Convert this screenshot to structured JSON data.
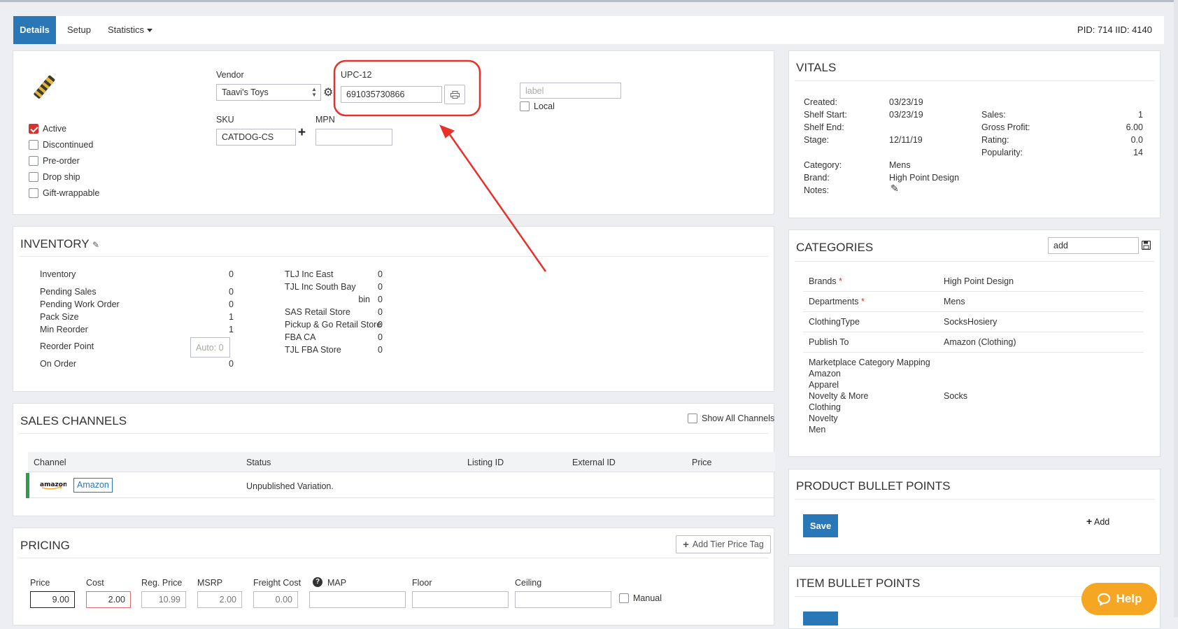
{
  "tabs": [
    {
      "label": "Details"
    },
    {
      "label": "Setup"
    },
    {
      "label": "Statistics"
    }
  ],
  "pid_text": "PID: 714 IID: 4140",
  "product": {
    "vendor_label": "Vendor",
    "vendor_value": "Taavi's Toys",
    "upc_label": "UPC-12",
    "upc_value": "691035730866",
    "label_placeholder": "label",
    "local_label": "Local",
    "sku_label": "SKU",
    "sku_value": "CATDOG-CS",
    "mpn_label": "MPN",
    "mpn_value": "",
    "flags": [
      {
        "label": "Active",
        "checked": true
      },
      {
        "label": "Discontinued",
        "checked": false
      },
      {
        "label": "Pre-order",
        "checked": false
      },
      {
        "label": "Drop ship",
        "checked": false
      },
      {
        "label": "Gift-wrappable",
        "checked": false
      }
    ]
  },
  "inventory": {
    "title": "INVENTORY",
    "left": [
      {
        "label": "Inventory",
        "value": "0"
      },
      {
        "label": "Pending Sales",
        "value": "0"
      },
      {
        "label": "Pending Work Order",
        "value": "0"
      },
      {
        "label": "Pack Size",
        "value": "1"
      },
      {
        "label": "Min Reorder",
        "value": "1"
      },
      {
        "label": "Reorder Point",
        "placeholder": "Auto: 0"
      },
      {
        "label": "On Order",
        "value": "0"
      }
    ],
    "right": [
      {
        "label": "TLJ Inc East",
        "value": "0"
      },
      {
        "label": "TJL Inc South Bay",
        "value": "0"
      },
      {
        "label": "bin",
        "value": "0"
      },
      {
        "label": "SAS Retail Store",
        "value": "0"
      },
      {
        "label": "Pickup & Go Retail Store",
        "value": "0"
      },
      {
        "label": "FBA CA",
        "value": "0"
      },
      {
        "label": "TJL FBA Store",
        "value": "0"
      }
    ]
  },
  "sales_channels": {
    "title": "SALES CHANNELS",
    "show_all_label": "Show All Channels",
    "columns": [
      "Channel",
      "Status",
      "Listing ID",
      "External ID",
      "Price"
    ],
    "rows": [
      {
        "logo": "amazon",
        "channel": "Amazon",
        "status": "Unpublished Variation."
      }
    ]
  },
  "pricing": {
    "title": "PRICING",
    "add_tier_label": "Add Tier Price Tag",
    "manual_label": "Manual",
    "fields": [
      {
        "label": "Price",
        "value": "9.00"
      },
      {
        "label": "Cost",
        "value": "2.00"
      },
      {
        "label": "Reg. Price",
        "value": "10.99"
      },
      {
        "label": "MSRP",
        "value": "2.00"
      },
      {
        "label": "Freight Cost",
        "value": "0.00"
      },
      {
        "label": "MAP",
        "value": ""
      },
      {
        "label": "Floor",
        "value": ""
      },
      {
        "label": "Ceiling",
        "value": ""
      }
    ]
  },
  "vitals": {
    "title": "VITALS",
    "left": [
      {
        "label": "Created:",
        "value": "03/23/19"
      },
      {
        "label": "Shelf Start:",
        "value": "03/23/19"
      },
      {
        "label": "Shelf End:",
        "value": ""
      },
      {
        "label": "Stage:",
        "value": "12/11/19"
      },
      {
        "label": "Category:",
        "value": "Mens"
      },
      {
        "label": "Brand:",
        "value": "High Point Design"
      },
      {
        "label": "Notes:",
        "value": ""
      }
    ],
    "right": [
      {
        "label": "Sales:",
        "value": "1"
      },
      {
        "label": "Gross Profit:",
        "value": "6.00"
      },
      {
        "label": "Rating:",
        "value": "0.0"
      },
      {
        "label": "Popularity:",
        "value": "14"
      }
    ]
  },
  "categories": {
    "title": "CATEGORIES",
    "add_value": "add",
    "rows": [
      {
        "label": "Brands",
        "required": "*",
        "value": "High Point Design"
      },
      {
        "label": "Departments",
        "required": "*",
        "value": "Mens"
      },
      {
        "label": "ClothingType",
        "required": "",
        "value": "SocksHosiery"
      },
      {
        "label": "Publish To",
        "required": "",
        "value": "Amazon (Clothing)"
      }
    ],
    "mapping_lines": [
      "Marketplace Category Mapping",
      "Amazon",
      "Apparel",
      "Novelty & More",
      "Clothing",
      "Novelty",
      "Men"
    ],
    "mapping_value": "Socks"
  },
  "bullet_points": {
    "title": "PRODUCT BULLET POINTS",
    "save_label": "Save",
    "add_label": "Add"
  },
  "item_bullet_points": {
    "title": "ITEM BULLET POINTS"
  },
  "help_label": "Help",
  "colors": {
    "accent": "#2a77b7",
    "annotation": "#e8312a",
    "help": "#f5a623",
    "amazon_bar": "#2e9e4b"
  }
}
